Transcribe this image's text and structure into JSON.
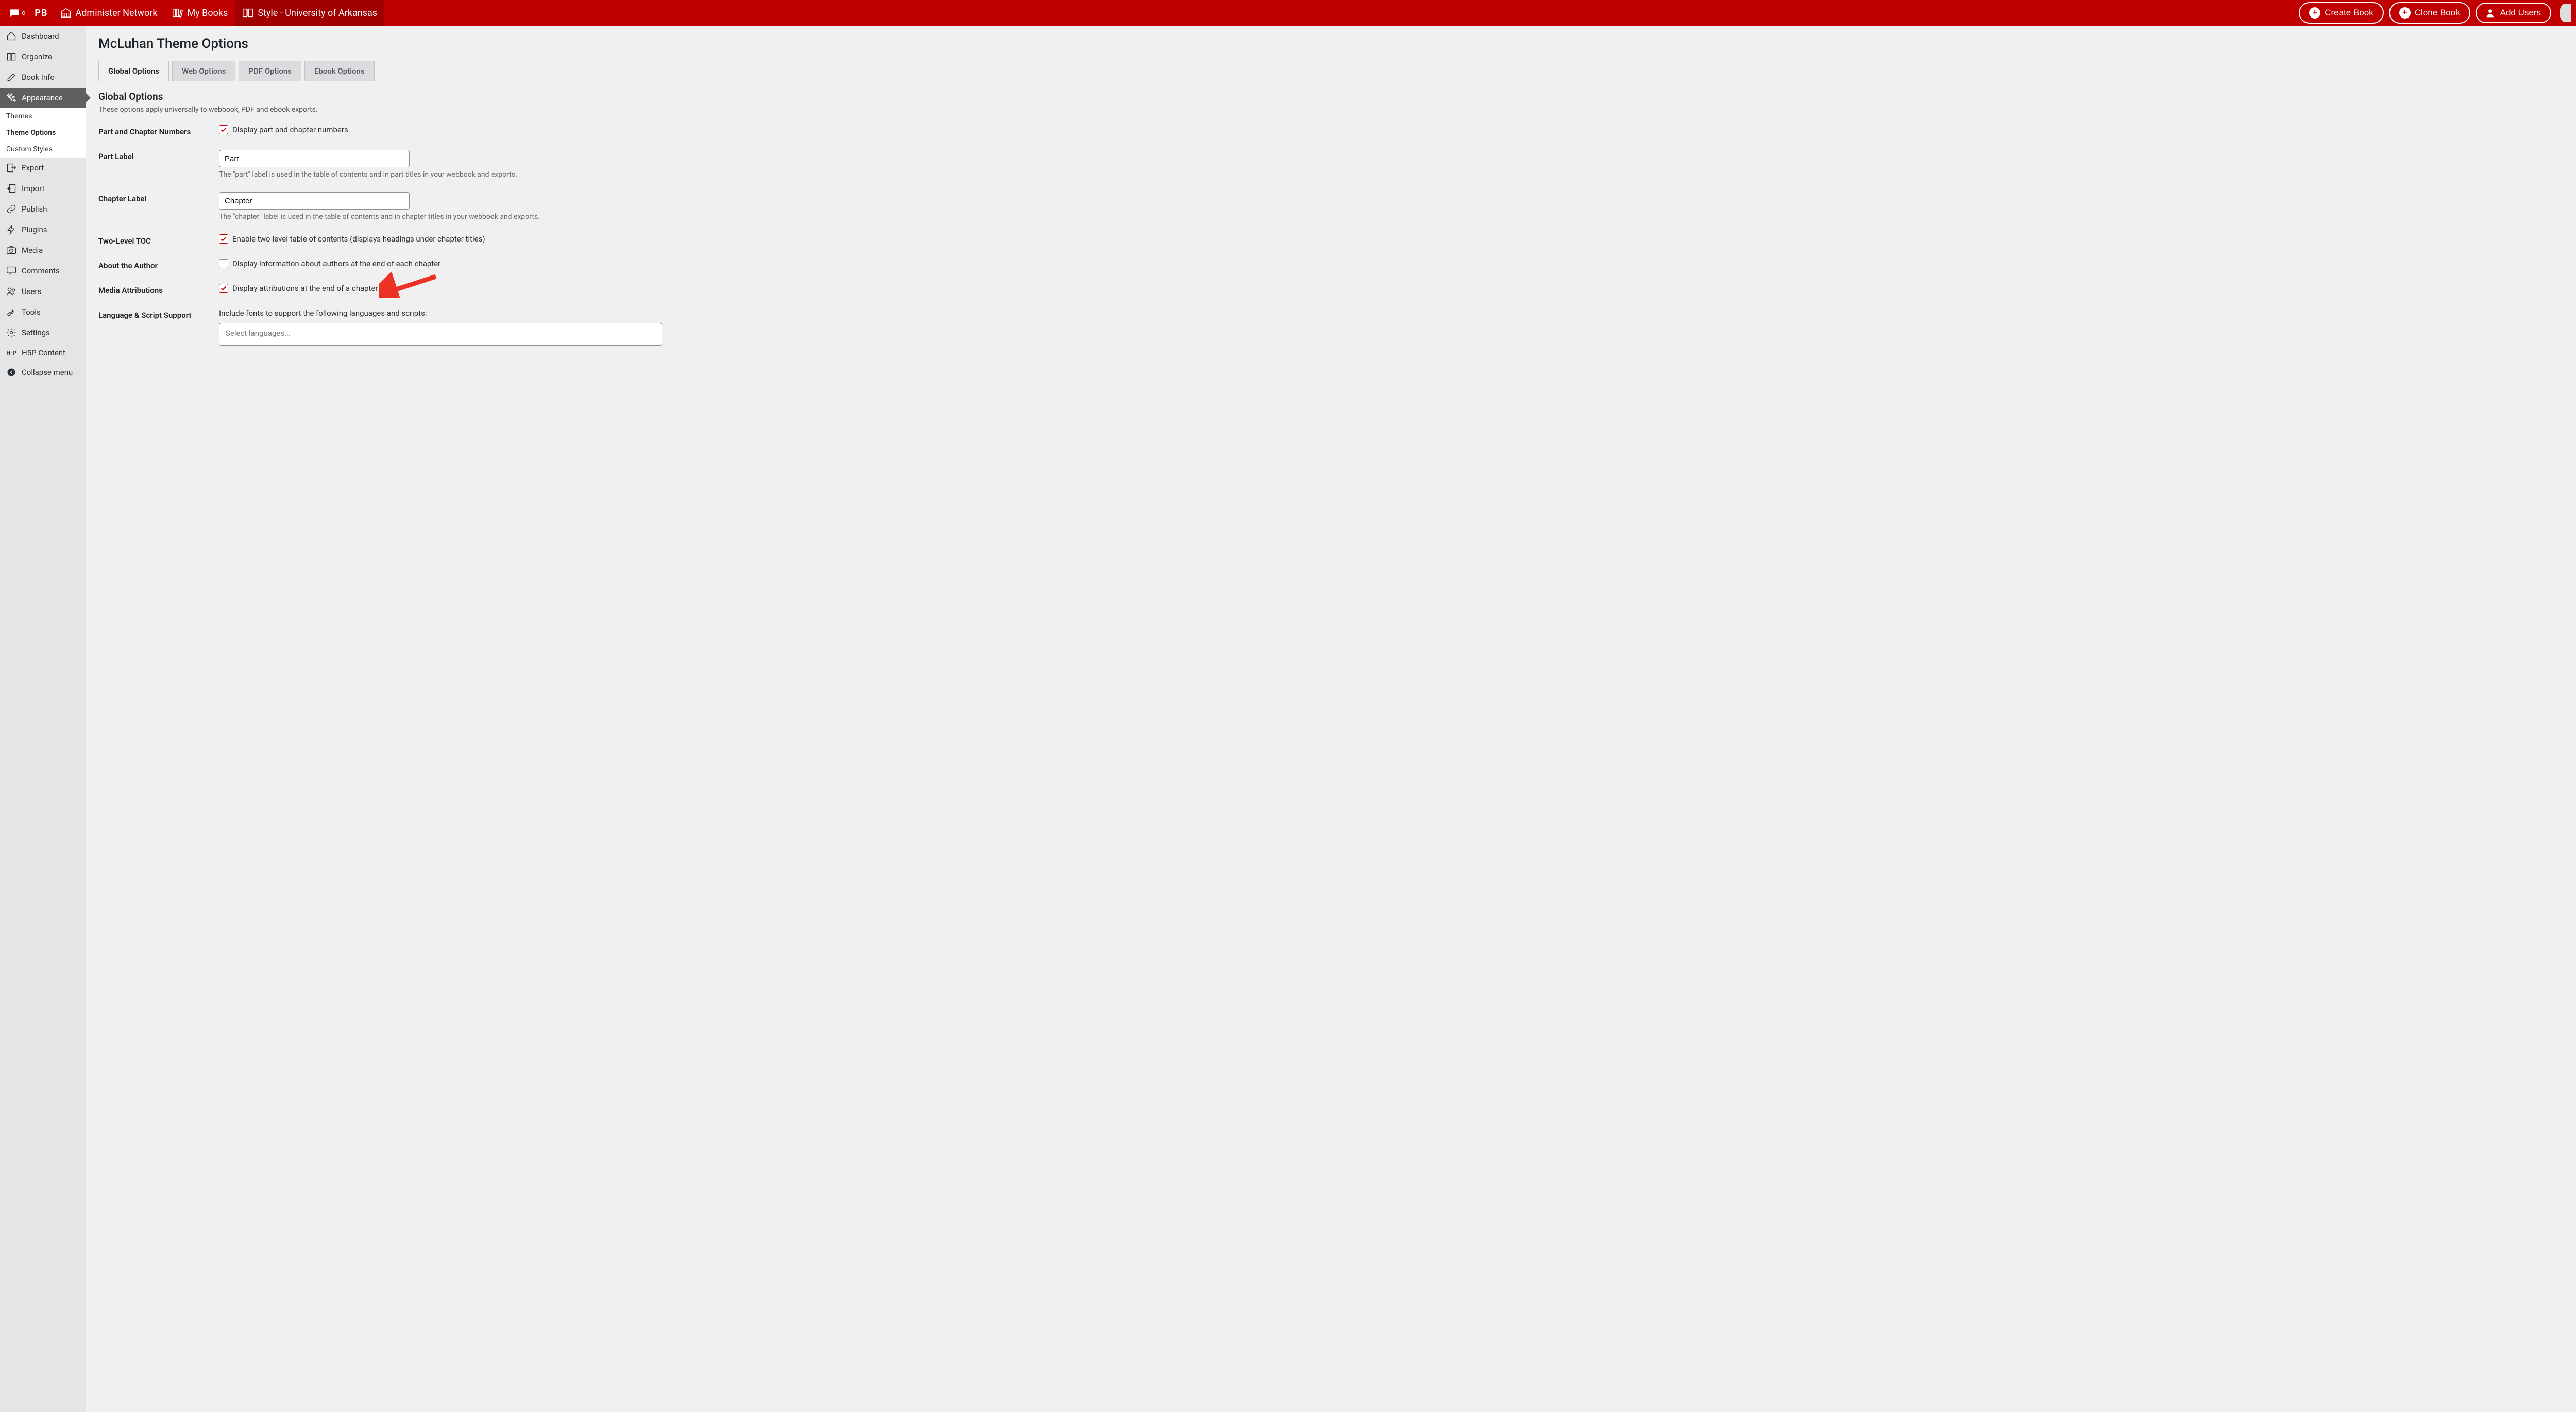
{
  "topbar": {
    "notifications": "o",
    "logo": "PB",
    "items": [
      {
        "label": "Administer Network",
        "icon": "building",
        "active": false
      },
      {
        "label": "My Books",
        "icon": "books",
        "active": false
      },
      {
        "label": "Style - University of Arkansas",
        "icon": "book-open",
        "active": true
      }
    ],
    "buttons": {
      "create": "Create Book",
      "clone": "Clone Book",
      "addusers": "Add Users"
    }
  },
  "sidebar": {
    "items": [
      {
        "label": "Dashboard",
        "icon": "home"
      },
      {
        "label": "Organize",
        "icon": "book"
      },
      {
        "label": "Book Info",
        "icon": "edit"
      },
      {
        "label": "Appearance",
        "icon": "sparkle",
        "active": true,
        "submenu": [
          {
            "label": "Themes"
          },
          {
            "label": "Theme Options",
            "active": true
          },
          {
            "label": "Custom Styles"
          }
        ]
      },
      {
        "label": "Export",
        "icon": "export"
      },
      {
        "label": "Import",
        "icon": "import"
      },
      {
        "label": "Publish",
        "icon": "link"
      },
      {
        "label": "Plugins",
        "icon": "bolt"
      },
      {
        "label": "Media",
        "icon": "camera"
      },
      {
        "label": "Comments",
        "icon": "comments"
      },
      {
        "label": "Users",
        "icon": "users"
      },
      {
        "label": "Tools",
        "icon": "wrench"
      },
      {
        "label": "Settings",
        "icon": "gear"
      },
      {
        "label": "H5P Content",
        "icon": "h5p"
      },
      {
        "label": "Collapse menu",
        "icon": "collapse"
      }
    ]
  },
  "page": {
    "title": "McLuhan Theme Options",
    "tabs": [
      {
        "label": "Global Options",
        "active": true
      },
      {
        "label": "Web Options"
      },
      {
        "label": "PDF Options"
      },
      {
        "label": "Ebook Options"
      }
    ],
    "section": {
      "title": "Global Options",
      "desc": "These options apply universally to webbook, PDF and ebook exports."
    },
    "rows": {
      "partChapterNumbers": {
        "label": "Part and Chapter Numbers",
        "cbLabel": "Display part and chapter numbers",
        "checked": true
      },
      "partLabel": {
        "label": "Part Label",
        "value": "Part",
        "help": "The \"part\" label is used in the table of contents and in part titles in your webbook and exports."
      },
      "chapterLabel": {
        "label": "Chapter Label",
        "value": "Chapter",
        "help": "The \"chapter\" label is used in the table of contents and in chapter titles in your webbook and exports."
      },
      "twoLevelToc": {
        "label": "Two-Level TOC",
        "cbLabel": "Enable two-level table of contents (displays headings under chapter titles)",
        "checked": true
      },
      "aboutAuthor": {
        "label": "About the Author",
        "cbLabel": "Display information about authors at the end of each chapter",
        "checked": false
      },
      "mediaAttrib": {
        "label": "Media Attributions",
        "cbLabel": "Display attributions at the end of a chapter",
        "checked": true
      },
      "langSupport": {
        "label": "Language & Script Support",
        "help": "Include fonts to support the following languages and scripts:",
        "placeholder": "Select languages..."
      }
    }
  }
}
